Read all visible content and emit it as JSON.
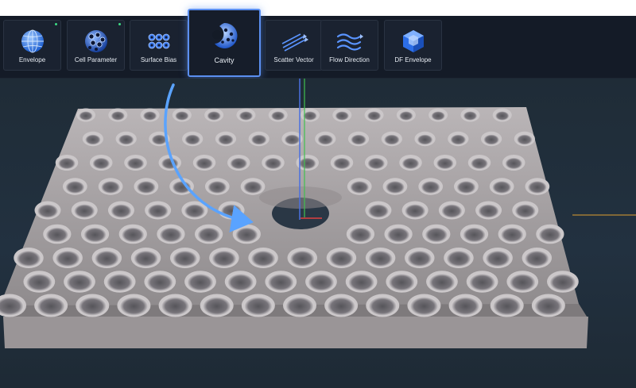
{
  "toolbar": {
    "tools": [
      {
        "label": "Envelope",
        "icon": "globe-icon",
        "indicator": true,
        "active": false
      },
      {
        "label": "Cell Parameter",
        "icon": "lattice-sphere-icon",
        "indicator": true,
        "active": false
      },
      {
        "label": "Surface Bias",
        "icon": "lattice-block-icon",
        "indicator": false,
        "active": false
      },
      {
        "label": "Cavity",
        "icon": "cavity-icon",
        "indicator": false,
        "active": true
      },
      {
        "label": "Scatter Vector",
        "icon": "scatter-vector-icon",
        "indicator": false,
        "active": false
      },
      {
        "label": "Flow Direction",
        "icon": "flow-direction-icon",
        "indicator": false,
        "active": false
      },
      {
        "label": "DF Envelope",
        "icon": "df-envelope-icon",
        "indicator": false,
        "active": false
      }
    ]
  },
  "colors": {
    "toolbar_bg": "#141b27",
    "accent": "#5b8ff0",
    "indicator": "#3ddc84",
    "viewport_bg": "#223140",
    "mesh": "#a29d9f",
    "axis_x": "#e04040",
    "axis_y": "#40c050",
    "axis_z": "#4a70e0",
    "axis_ground": "#e0a030"
  }
}
